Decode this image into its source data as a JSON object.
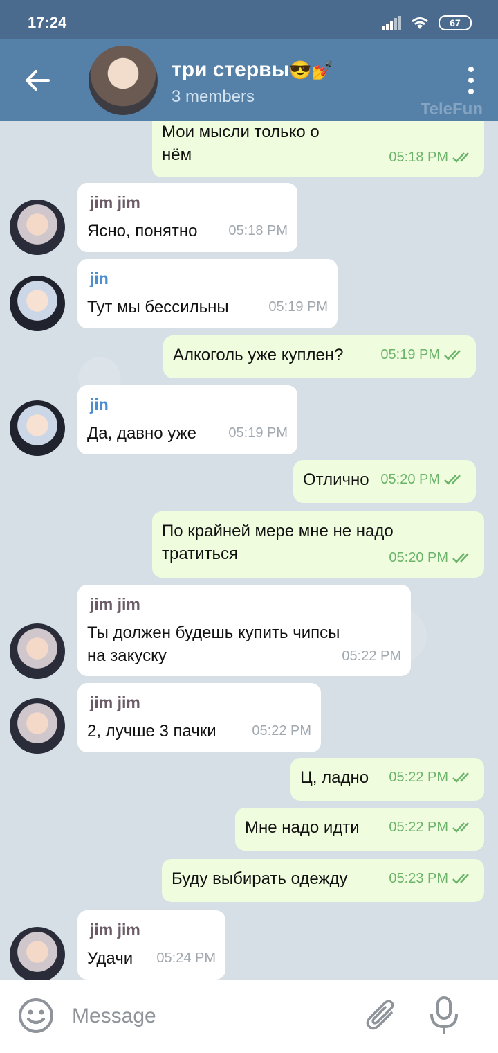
{
  "status_bar": {
    "time": "17:24",
    "battery": "67"
  },
  "header": {
    "title": "три стервы",
    "title_emoji": "😎💅",
    "subtitle": "3 members",
    "watermark": "TeleFun"
  },
  "messages": [
    {
      "dir": "out",
      "text": "Мои мысли только о нём",
      "time": "05:18 PM"
    },
    {
      "dir": "in",
      "sender": "jim jim",
      "text": "Ясно, понятно",
      "time": "05:18 PM"
    },
    {
      "dir": "in",
      "sender": "jin",
      "text": "Тут мы бессильны",
      "time": "05:19 PM"
    },
    {
      "dir": "out",
      "text": "Алкоголь уже куплен?",
      "time": "05:19 PM"
    },
    {
      "dir": "in",
      "sender": "jin",
      "text": "Да, давно уже",
      "time": "05:19 PM"
    },
    {
      "dir": "out",
      "text": "Отлично",
      "time": "05:20 PM"
    },
    {
      "dir": "out",
      "text": "По крайней мере мне не надо тратиться",
      "time": "05:20 PM"
    },
    {
      "dir": "in",
      "sender": "jim jim",
      "text": "Ты должен будешь купить чипсы на закуску",
      "time": "05:22 PM"
    },
    {
      "dir": "in",
      "sender": "jim jim",
      "text": "2, лучше 3 пачки",
      "time": "05:22 PM"
    },
    {
      "dir": "out",
      "text": "Ц, ладно",
      "time": "05:22 PM"
    },
    {
      "dir": "out",
      "text": "Мне надо идти",
      "time": "05:22 PM"
    },
    {
      "dir": "out",
      "text": "Буду выбирать одежду",
      "time": "05:23 PM"
    },
    {
      "dir": "in",
      "sender": "jim jim",
      "text": "Удачи",
      "time": "05:24 PM"
    }
  ],
  "input": {
    "placeholder": "Message"
  },
  "colors": {
    "header": "#5581a9",
    "status_bar": "#4a6b8e",
    "outgoing": "#effdde",
    "incoming": "#ffffff",
    "check": "#6bb46a"
  },
  "icons": {
    "back": "arrow-left-icon",
    "menu": "more-vertical-icon",
    "emoji": "smiley-icon",
    "attach": "paperclip-icon",
    "voice": "microphone-icon",
    "read": "double-check-icon"
  }
}
